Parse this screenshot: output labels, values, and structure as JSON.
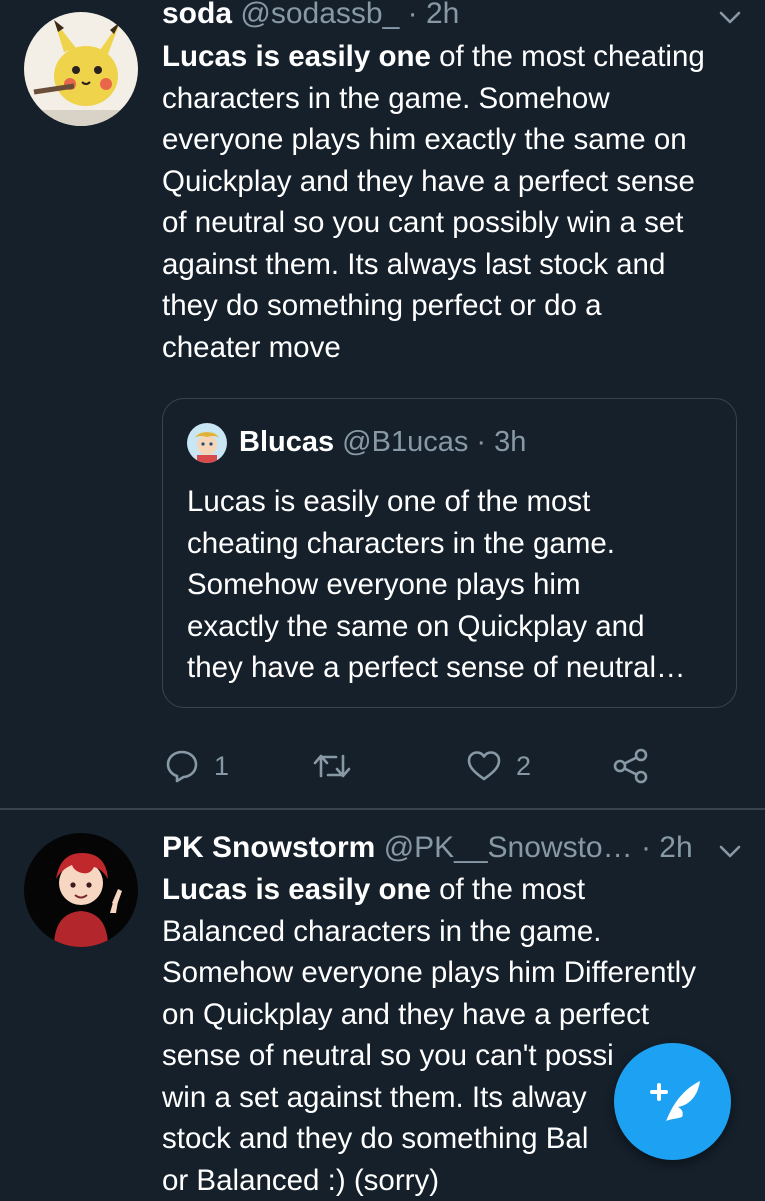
{
  "tweets": [
    {
      "name": "soda",
      "handle": "@sodassb_",
      "separator": "·",
      "time": "2h",
      "text_bold": "Lucas is easily one",
      "text_rest": " of the most cheating\ncharacters in the game. Somehow\neveryone plays him exactly the same on\nQuickplay and they have a perfect sense\nof neutral so you cant possibly win a set\nagainst them. Its always last stock and\nthey do something perfect or do a\ncheater move",
      "quote": {
        "name": "Blucas",
        "handle": "@B1ucas",
        "separator": "·",
        "time": "3h",
        "text": "Lucas is easily one of the most\ncheating characters in the game.\nSomehow everyone plays him\nexactly the same on Quickplay and\nthey have a perfect sense of neutral…"
      },
      "actions": {
        "replies": "1",
        "retweets": "",
        "likes": "2"
      }
    },
    {
      "name": "PK Snowstorm",
      "handle": "@PK__Snowsto…",
      "separator": "·",
      "time": "2h",
      "text_bold": "Lucas is easily one",
      "text_rest": " of the most\nBalanced characters in the game.\nSomehow everyone plays him Differently\non Quickplay and they have a perfect\nsense of neutral so you can't possi\nwin a set against them. Its alway\nstock and they do something Bal\nor Balanced :) (sorry)"
    }
  ],
  "colors": {
    "background": "#15202b",
    "secondary_text": "#8899a6",
    "border": "#38444d",
    "accent": "#1da1f2"
  },
  "icons": {
    "reply": "reply-icon",
    "retweet": "retweet-icon",
    "like": "heart-icon",
    "share": "share-icon",
    "caret": "chevron-down-icon",
    "compose": "compose-tweet-icon"
  }
}
